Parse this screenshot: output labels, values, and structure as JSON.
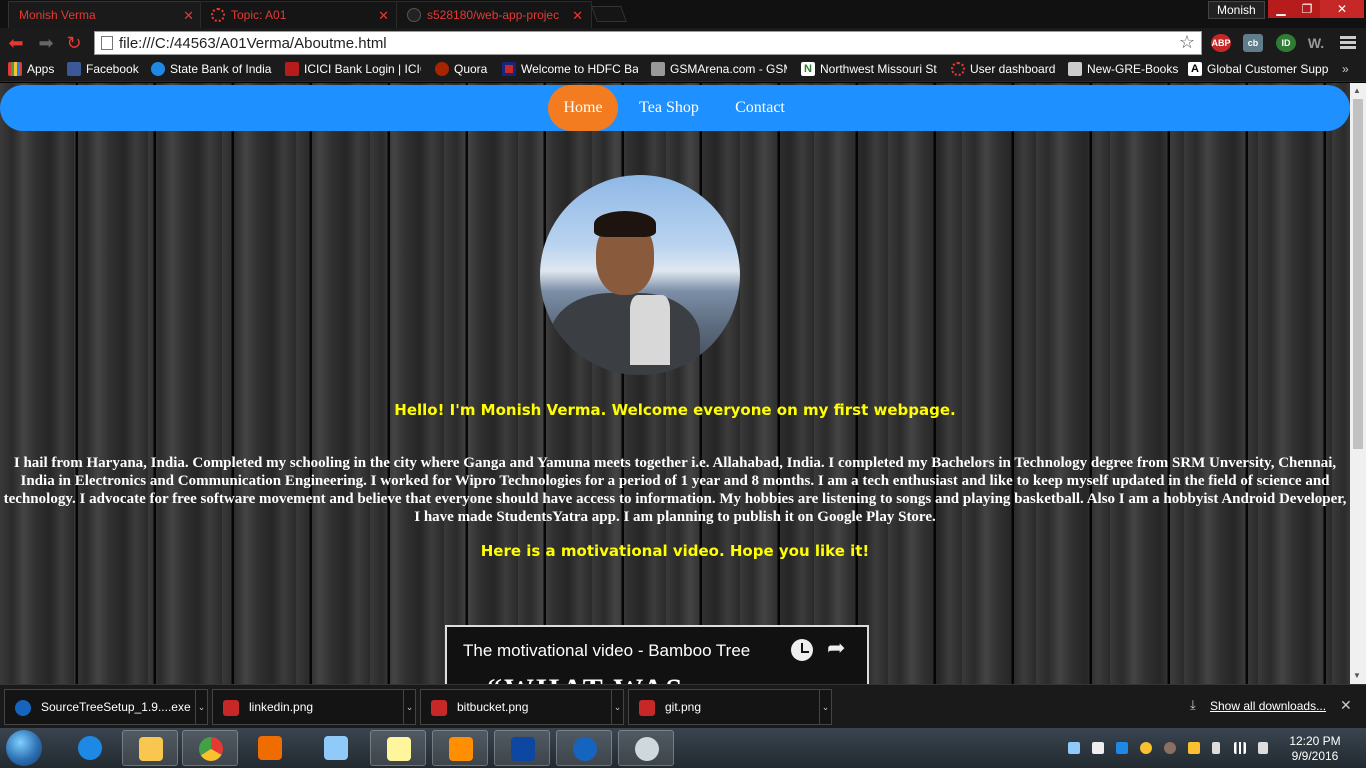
{
  "browser": {
    "tabs": [
      {
        "title": "Monish Verma"
      },
      {
        "title": "Topic: A01"
      },
      {
        "title": "s528180/web-app-projec"
      }
    ],
    "profile": "Monish",
    "url": "file:///C:/44563/A01Verma/Aboutme.html",
    "extensions": {
      "abp": "ABP",
      "cb": "cb",
      "id": "ID",
      "w": "W."
    },
    "bookmarks": [
      "Apps",
      "Facebook",
      "State Bank of India",
      "ICICI Bank Login | ICIC",
      "Quora",
      "Welcome to HDFC Ba",
      "GSMArena.com - GSM",
      "Northwest Missouri St",
      "User dashboard",
      "New-GRE-Books",
      "Global Customer Supp"
    ]
  },
  "site": {
    "nav": {
      "home": "Home",
      "tea_shop": "Tea Shop",
      "contact": "Contact"
    },
    "greeting": "Hello! I'm Monish Verma. Welcome everyone on my first webpage.",
    "bio": "I hail from Haryana, India. Completed my schooling in the city where Ganga and Yamuna meets together i.e. Allahabad, India. I completed my Bachelors in Technology degree from SRM Unversity, Chennai, India in Electronics and Communication Engineering. I worked for Wipro Technologies for a period of 1 year and 8 months. I am a tech enthusiast and like to keep myself updated in the field of science and technology. I advocate for free software movement and believe that everyone should have access to information. My hobbies are listening to songs and playing basketball. Also I am a hobbyist Android Developer, I have made StudentsYatra app. I am planning to publish it on Google Play Store.",
    "video_heading": "Here is a motivational video. Hope you like it!",
    "video": {
      "title": "The motivational video - Bamboo Tree",
      "overlay": "“WHAT WAS HAPPENING"
    }
  },
  "downloads": {
    "items": [
      {
        "name": "SourceTreeSetup_1.9....exe"
      },
      {
        "name": "linkedin.png"
      },
      {
        "name": "bitbucket.png"
      },
      {
        "name": "git.png"
      }
    ],
    "show_all": "Show all downloads..."
  },
  "taskbar": {
    "time": "12:20 PM",
    "date": "9/9/2016"
  }
}
